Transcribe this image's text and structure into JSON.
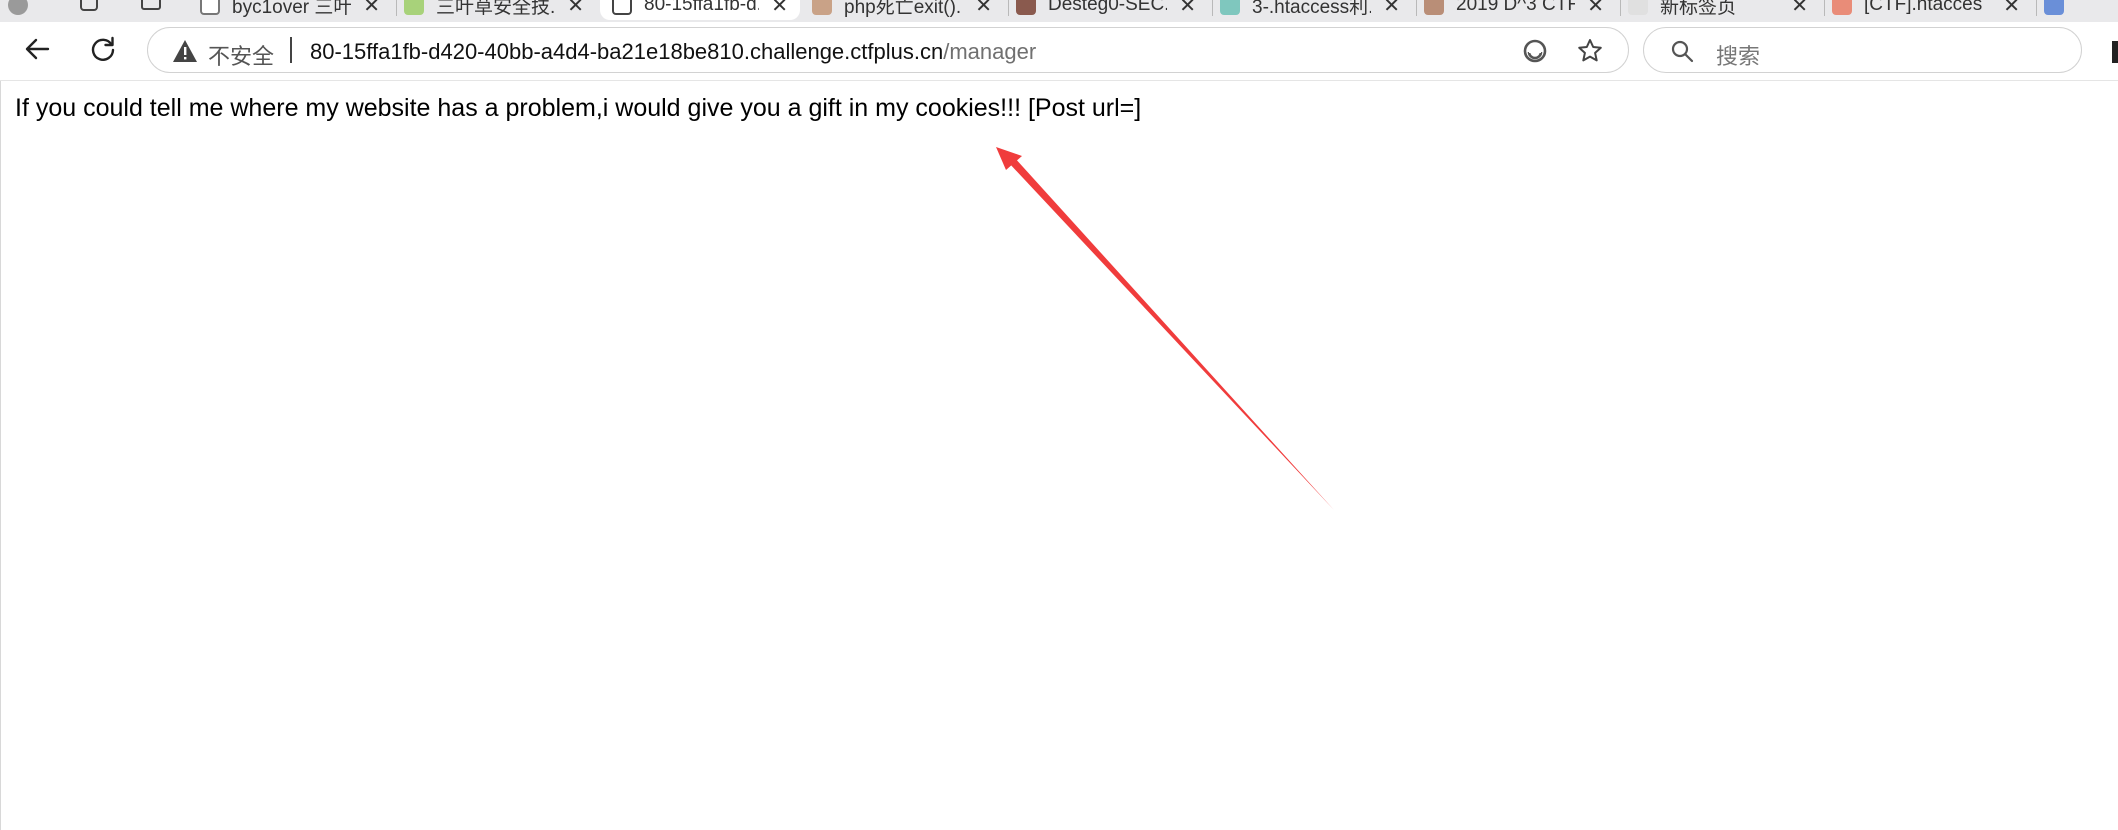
{
  "tabs": [
    {
      "title": "byc1over 三叶...",
      "fav_color": "#cfcfcf"
    },
    {
      "title": "三叶草安全技...",
      "fav_color": "#a8d27a"
    },
    {
      "title": "80-15ffa1fb-d...",
      "fav_color": "#ffffff"
    },
    {
      "title": "php死亡exit()...",
      "fav_color": "#c9a287"
    },
    {
      "title": "Desteg0-SEC...",
      "fav_color": "#8a5a4e"
    },
    {
      "title": "3-.htaccess利...",
      "fav_color": "#7fc7be"
    },
    {
      "title": "2019 D^3 CTF...",
      "fav_color": "#b98e77"
    },
    {
      "title": "新标签页",
      "fav_color": "#e0e0e0"
    },
    {
      "title": "[CTF].htacces...",
      "fav_color": "#e98c78"
    }
  ],
  "tab_close_glyph": "✕",
  "address_bar": {
    "security_label": "不安全",
    "url_host": "80-15ffa1fb-d420-40bb-a4d4-ba21e18be810.challenge.ctfplus.cn",
    "url_path": "/manager"
  },
  "search": {
    "placeholder": "搜索"
  },
  "page": {
    "text": "If you could tell me where my website has a problem,i would give you a gift in my cookies!!! [Post url=]"
  },
  "colors": {
    "annotation_arrow": "#f03c3c",
    "tab_strip": "#e9e9eb"
  }
}
